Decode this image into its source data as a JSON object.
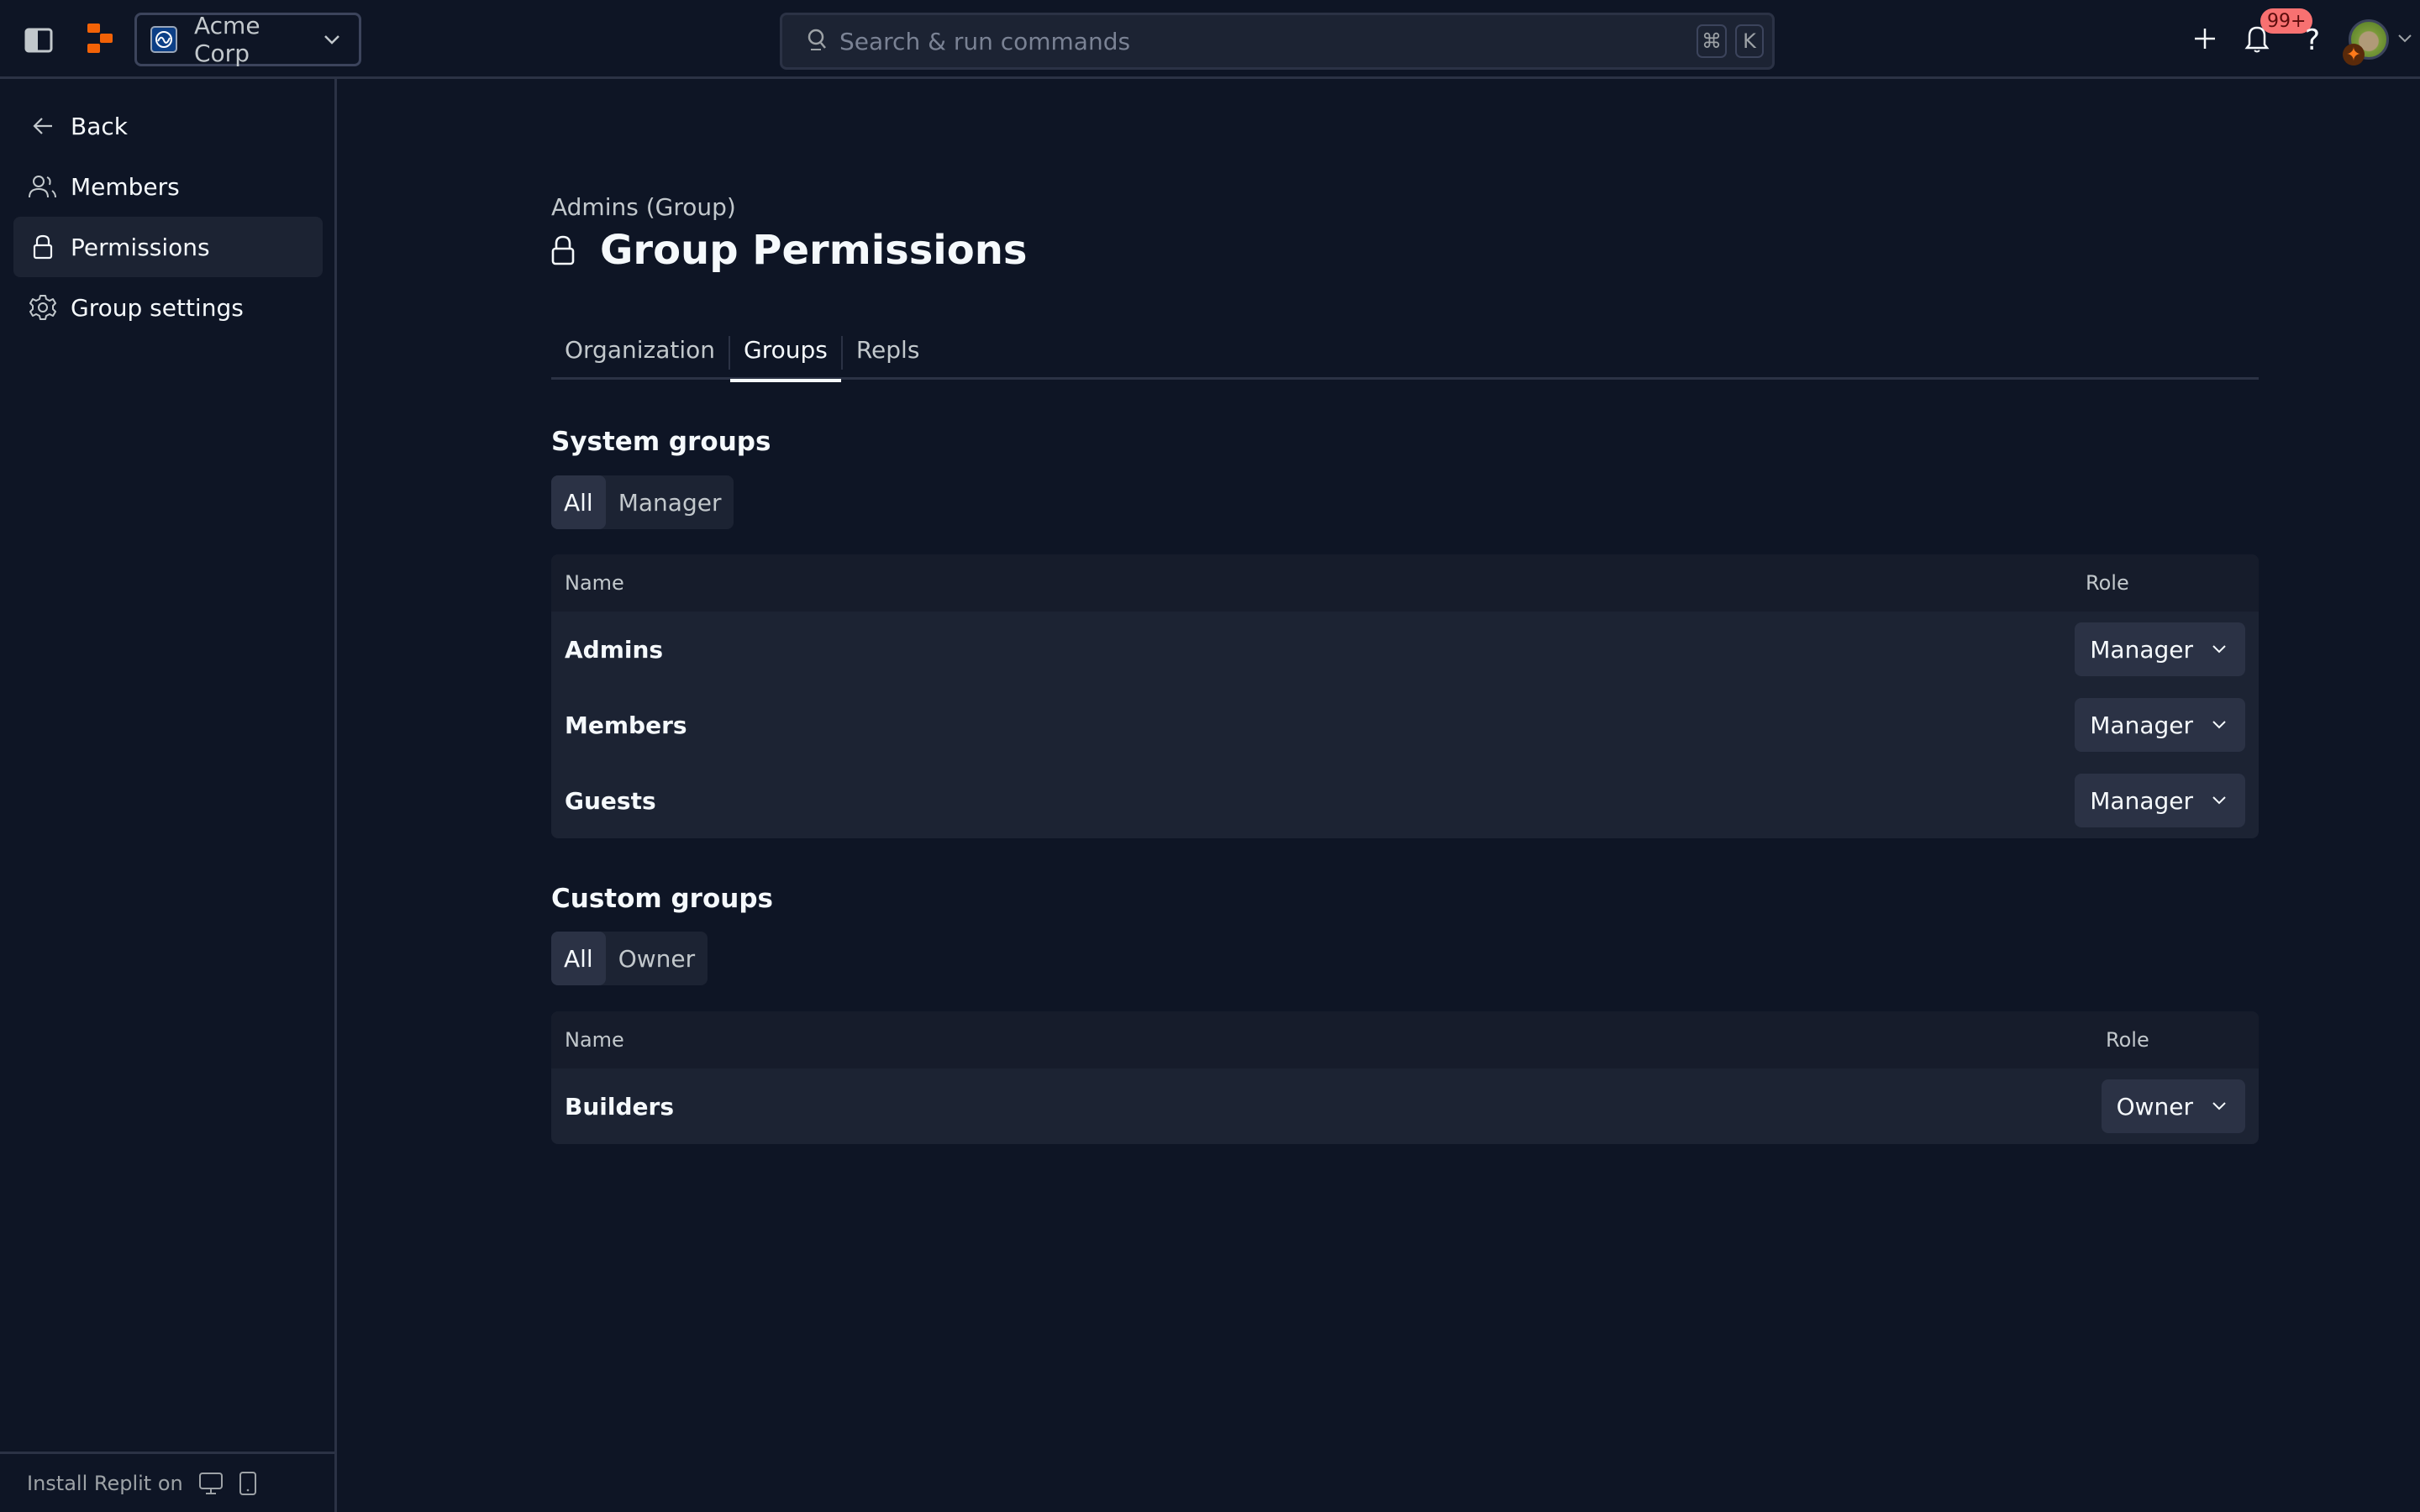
{
  "topbar": {
    "org_name": "Acme Corp",
    "search_placeholder": "Search & run commands",
    "shortcut_keys": [
      "⌘",
      "K"
    ],
    "notification_badge": "99+",
    "help_label": "?",
    "accent_color": "#f26207"
  },
  "sidebar": {
    "items": [
      {
        "label": "Back",
        "icon": "arrow-left-icon"
      },
      {
        "label": "Members",
        "icon": "users-icon"
      },
      {
        "label": "Permissions",
        "icon": "lock-icon",
        "active": true
      },
      {
        "label": "Group settings",
        "icon": "gear-icon"
      }
    ],
    "footer_label": "Install Replit on"
  },
  "main": {
    "subtitle": "Admins (Group)",
    "title": "Group Permissions",
    "tabs": [
      {
        "label": "Organization"
      },
      {
        "label": "Groups",
        "active": true
      },
      {
        "label": "Repls"
      }
    ],
    "system_groups": {
      "title": "System groups",
      "filters": [
        {
          "label": "All",
          "active": true
        },
        {
          "label": "Manager"
        }
      ],
      "columns": [
        "Name",
        "Role"
      ],
      "rows": [
        {
          "name": "Admins",
          "role": "Manager"
        },
        {
          "name": "Members",
          "role": "Manager"
        },
        {
          "name": "Guests",
          "role": "Manager"
        }
      ]
    },
    "custom_groups": {
      "title": "Custom groups",
      "filters": [
        {
          "label": "All",
          "active": true
        },
        {
          "label": "Owner"
        }
      ],
      "columns": [
        "Name",
        "Role"
      ],
      "rows": [
        {
          "name": "Builders",
          "role": "Owner"
        }
      ]
    }
  }
}
